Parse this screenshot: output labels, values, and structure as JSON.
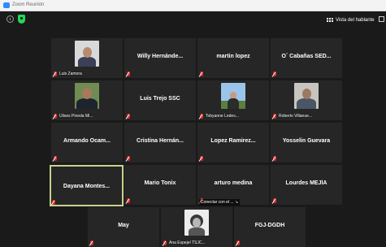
{
  "window": {
    "title": "Zoom Reunión"
  },
  "toolbar": {
    "view_label": "Vista del hablante"
  },
  "participants": [
    {
      "name": "",
      "label": "Luis Zamora"
    },
    {
      "name": "Willy Hernánde...",
      "label": ""
    },
    {
      "name": "martin lopez",
      "label": ""
    },
    {
      "name": "O´ Cabañas SED...",
      "label": ""
    },
    {
      "name": "",
      "label": "Ulises Pineda Mi..."
    },
    {
      "name": "Luis Trejo SSC",
      "label": ""
    },
    {
      "name": "",
      "label": "Tobyanne Ledes..."
    },
    {
      "name": "",
      "label": "Roberto Villanue..."
    },
    {
      "name": "Armando Ocam...",
      "label": ""
    },
    {
      "name": "Cristina Hernán...",
      "label": ""
    },
    {
      "name": "Lopez Ramirez...",
      "label": ""
    },
    {
      "name": "Yosselin Guevara",
      "label": ""
    },
    {
      "name": "Dayana Montes...",
      "label": ""
    },
    {
      "name": "Mario Tonix",
      "label": ""
    },
    {
      "name": "arturo medina",
      "label": ""
    },
    {
      "name": "Lourdes MEJÍA",
      "label": ""
    },
    {
      "name": "May",
      "label": ""
    },
    {
      "name": "",
      "label": "Ana Espejel TSJC..."
    },
    {
      "name": "FGJ-DGDH",
      "label": ""
    }
  ],
  "status": {
    "connecting": "Conectar con el ... ↘"
  },
  "colors": {
    "mic_muted": "#e02828",
    "active_border": "#c9d28a",
    "security": "#23d959",
    "zoom_blue": "#2d8cff"
  }
}
